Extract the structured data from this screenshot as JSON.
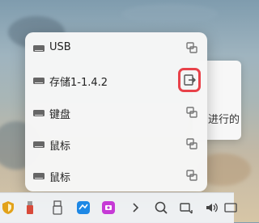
{
  "popup": {
    "devices": [
      {
        "name": "USB",
        "icon": "drive-icon",
        "action_icon": "unlink-icon"
      },
      {
        "name": "存储1-1.4.2",
        "icon": "drive-icon",
        "action_icon": "eject-icon"
      },
      {
        "name": "键盘",
        "icon": "drive-icon",
        "action_icon": "unlink-icon"
      },
      {
        "name": "鼠标",
        "icon": "drive-icon",
        "action_icon": "unlink-icon"
      },
      {
        "name": "鼠标",
        "icon": "drive-icon",
        "action_icon": "unlink-icon"
      }
    ]
  },
  "background_window": {
    "partial_text": "进行的"
  },
  "taskbar": {
    "icons": [
      "shield-icon",
      "usb-stick-icon",
      "pen-drive-icon",
      "app-blue-icon",
      "app-purple-icon",
      "chevron-right-icon",
      "search-icon",
      "network-icon",
      "volume-icon",
      "battery-icon"
    ]
  },
  "colors": {
    "highlight": "#e8424a"
  }
}
